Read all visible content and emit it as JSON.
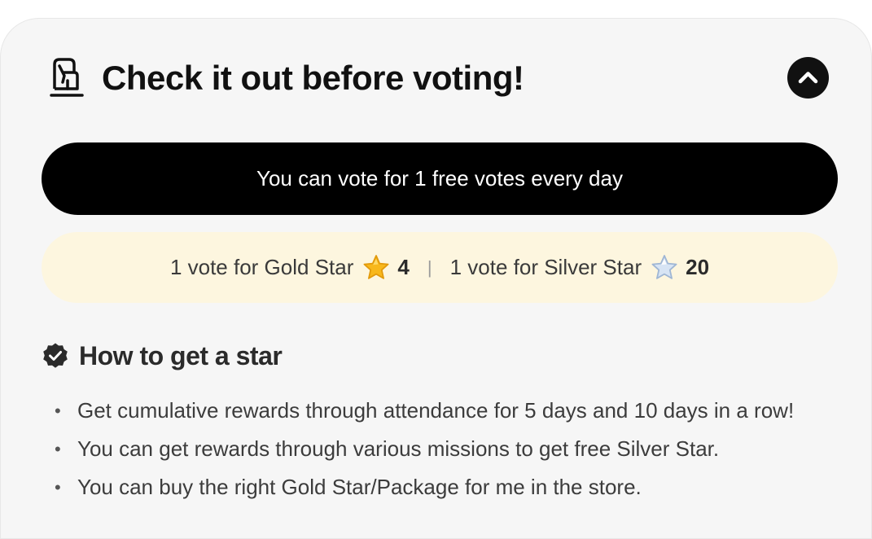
{
  "header": {
    "title": "Check it out before voting!",
    "icon": "vote-hand-icon",
    "collapse_icon": "chevron-up-icon"
  },
  "free_votes": {
    "label": "You can vote for 1 free votes every day"
  },
  "rates": {
    "gold_label": "1 vote for Gold Star",
    "gold_icon": "gold-star-icon",
    "gold_count": "4",
    "divider": "|",
    "silver_label": "1 vote for Silver Star",
    "silver_icon": "silver-star-icon",
    "silver_count": "20"
  },
  "how_to": {
    "icon": "verified-badge-icon",
    "title": "How to get a star",
    "items": [
      "Get cumulative rewards through attendance for 5 days and 10 days in a row!",
      "You can get rewards through various missions to get free Silver Star.",
      "You can buy the right Gold Star/Package for me in the store."
    ]
  },
  "colors": {
    "card_background": "#f6f6f6",
    "primary_black": "#000000",
    "rate_box_background": "#fdf6df",
    "gold_star": "#f8b81c",
    "silver_star": "#d7e4f4"
  }
}
